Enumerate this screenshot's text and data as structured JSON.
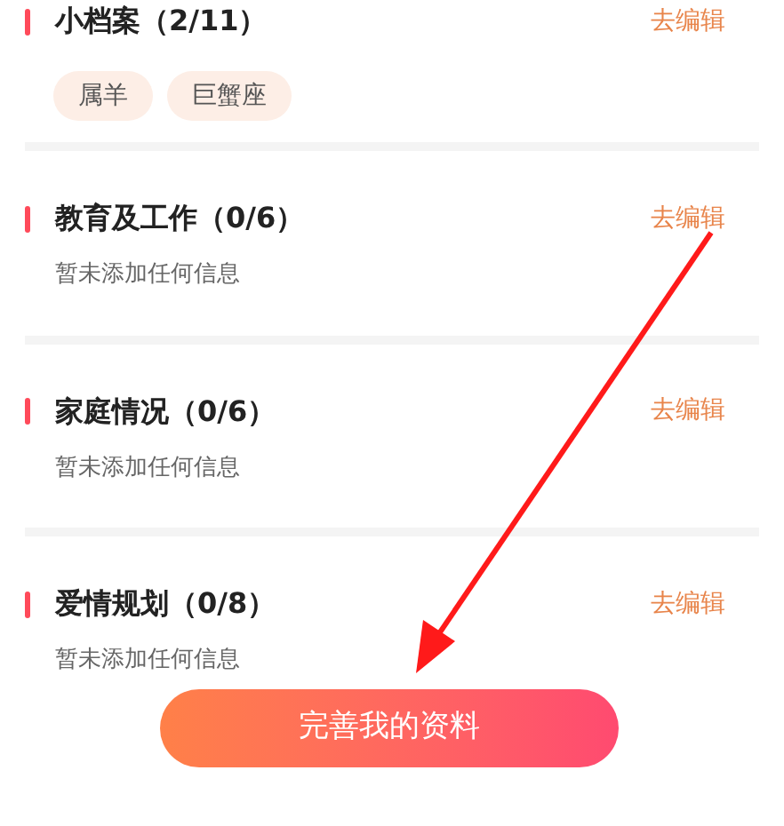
{
  "sections": [
    {
      "title": "小档案（2/11）",
      "action": "去编辑",
      "kind": "tags",
      "tags": [
        "属羊",
        "巨蟹座"
      ]
    },
    {
      "title": "教育及工作（0/6）",
      "action": "去编辑",
      "kind": "empty",
      "note": "暂未添加任何信息"
    },
    {
      "title": "家庭情况（0/6）",
      "action": "去编辑",
      "kind": "empty",
      "note": "暂未添加任何信息"
    },
    {
      "title": "爱情规划（0/8）",
      "action": "去编辑",
      "kind": "empty",
      "note": "暂未添加任何信息"
    }
  ],
  "primary_button": "完善我的资料"
}
